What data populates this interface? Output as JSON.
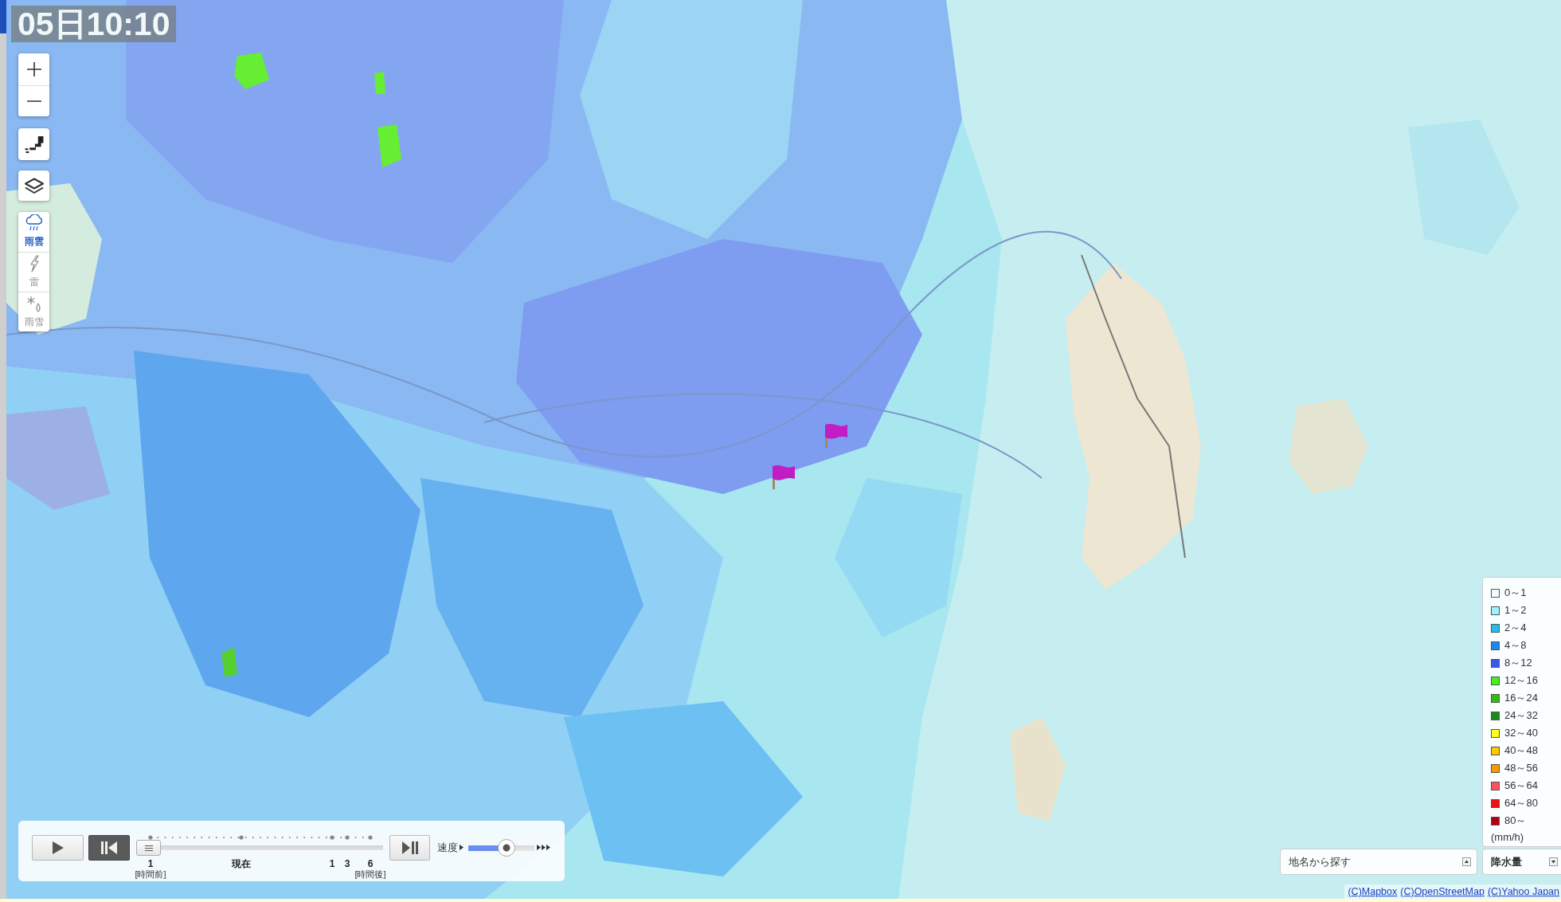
{
  "time_label": "05日10:10",
  "layer_tabs": [
    {
      "label": "雨雲",
      "kind": "rain-cloud",
      "selected": true
    },
    {
      "label": "雷",
      "kind": "lightning",
      "selected": false
    },
    {
      "label": "雨雪",
      "kind": "snow-rain",
      "selected": false
    }
  ],
  "player": {
    "play_button": {
      "pressed": false
    },
    "rewind_button": {
      "pressed": true
    },
    "timeline": {
      "level": 0,
      "marks": [
        {
          "label": "1",
          "note": "[時間前]"
        },
        {
          "label": "現在"
        },
        {
          "label": "1"
        },
        {
          "label": "3"
        },
        {
          "label": "6",
          "note": "[時間後]"
        }
      ]
    },
    "step_button": {
      "pressed": false
    },
    "speed": {
      "label": "速度",
      "level": 0.6
    }
  },
  "search": {
    "placeholder": "地名から探す"
  },
  "legend": {
    "items": [
      {
        "label": "0～1",
        "color": "#f2fcff"
      },
      {
        "label": "1～2",
        "color": "#a0f2fc"
      },
      {
        "label": "2～4",
        "color": "#20bef2"
      },
      {
        "label": "4～8",
        "color": "#1e88ee"
      },
      {
        "label": "8～12",
        "color": "#3858f2"
      },
      {
        "label": "12～16",
        "color": "#44f022"
      },
      {
        "label": "16～24",
        "color": "#30bc10"
      },
      {
        "label": "24～32",
        "color": "#1c8a18"
      },
      {
        "label": "32～40",
        "color": "#ffff20"
      },
      {
        "label": "40～48",
        "color": "#ffc800"
      },
      {
        "label": "48～56",
        "color": "#ff9600"
      },
      {
        "label": "56～64",
        "color": "#ff5064"
      },
      {
        "label": "64～80",
        "color": "#f01010"
      },
      {
        "label": "80～",
        "color": "#b00014"
      }
    ],
    "unit": "(mm/h)"
  },
  "data_dropdown": {
    "value": "降水量"
  },
  "attribution": {
    "links": [
      "(C)Mapbox",
      "(C)OpenStreetMap",
      "(C)Yahoo Japan"
    ]
  }
}
